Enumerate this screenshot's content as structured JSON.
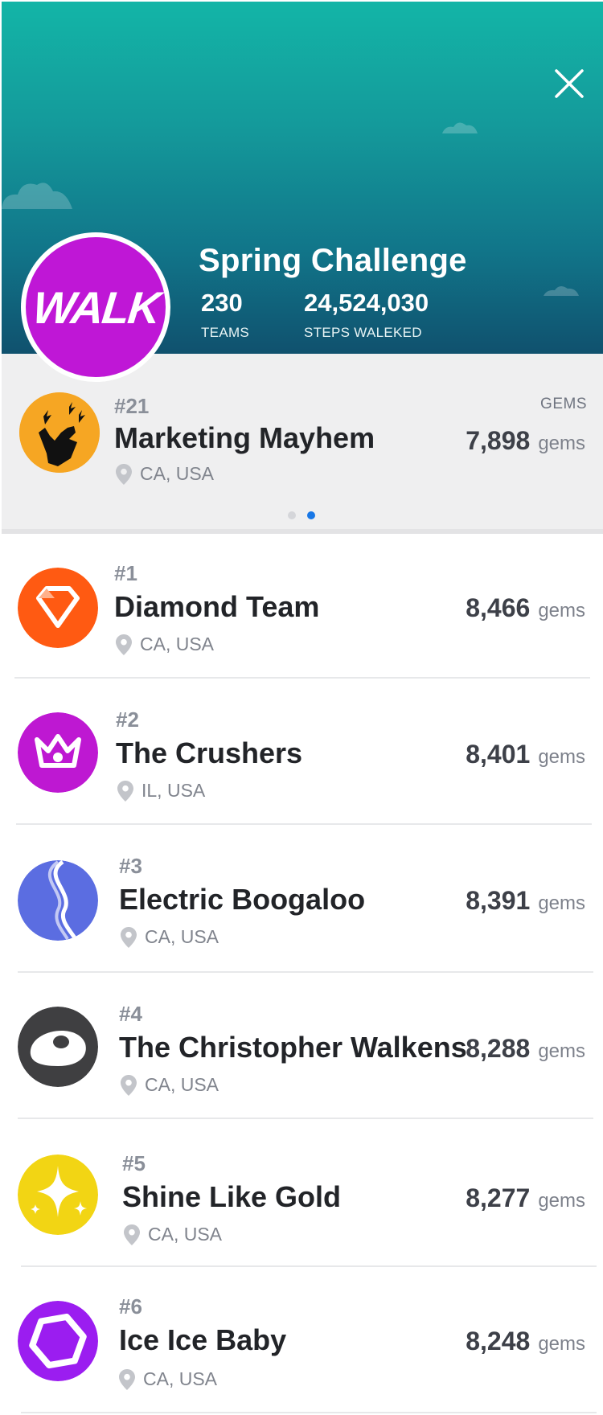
{
  "challenge": {
    "title": "Spring Challenge",
    "logo_text": "WALK",
    "teams_value": "230",
    "teams_label": "TEAMS",
    "steps_value": "24,524,030",
    "steps_label": "STEPS WALEKED"
  },
  "my_team": {
    "rank": "#21",
    "name": "Marketing Mayhem",
    "location": "CA, USA",
    "gems_header": "GEMS",
    "gems": "7,898",
    "gems_unit": "gems"
  },
  "pager": {
    "pages": 2,
    "active_index": 1
  },
  "leaderboard": [
    {
      "rank": "#1",
      "name": "Diamond Team",
      "location": "CA, USA",
      "gems": "8,466",
      "unit": "gems",
      "icon": "diamond-icon",
      "color": "#ff5a12"
    },
    {
      "rank": "#2",
      "name": "The Crushers",
      "location": "IL, USA",
      "gems": "8,401",
      "unit": "gems",
      "icon": "crown-icon",
      "color": "#be18d2"
    },
    {
      "rank": "#3",
      "name": "Electric Boogaloo",
      "location": "CA, USA",
      "gems": "8,391",
      "unit": "gems",
      "icon": "wave-icon",
      "color": "#5b6de1"
    },
    {
      "rank": "#4",
      "name": "The Christopher Walkens",
      "location": "CA, USA",
      "gems": "8,288",
      "unit": "gems",
      "icon": "eye-icon",
      "color": "#3f3f41"
    },
    {
      "rank": "#5",
      "name": "Shine Like Gold",
      "location": "CA, USA",
      "gems": "8,277",
      "unit": "gems",
      "icon": "sparkle-icon",
      "color": "#f2d514"
    },
    {
      "rank": "#6",
      "name": "Ice Ice Baby",
      "location": "CA, USA",
      "gems": "8,248",
      "unit": "gems",
      "icon": "hexagon-icon",
      "color": "#9b1df0"
    }
  ],
  "colors": {
    "header_top": "#13b5a7",
    "header_bottom": "#10516e",
    "my_team_avatar": "#f6a623",
    "pager_active": "#1877e6"
  }
}
